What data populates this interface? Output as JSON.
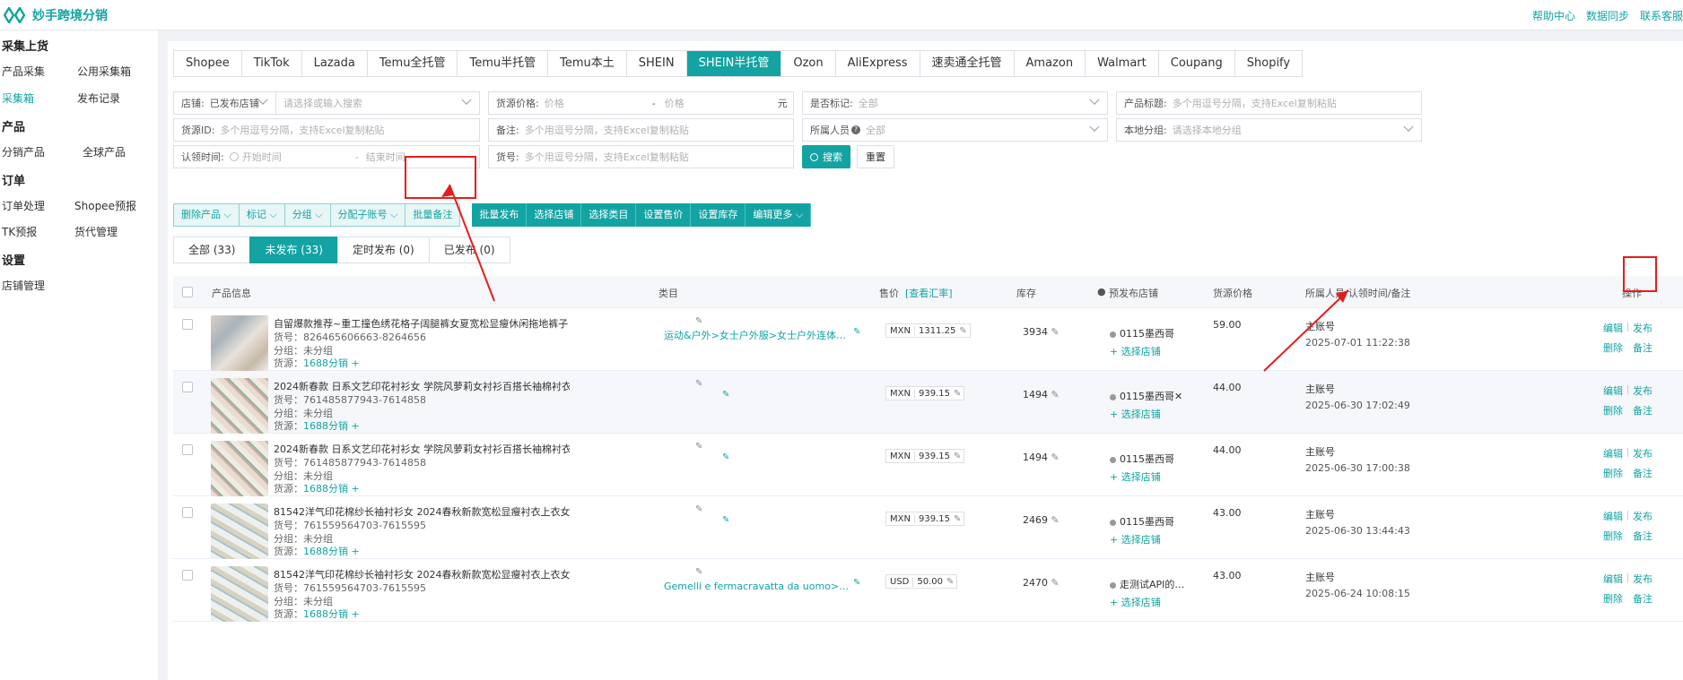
{
  "header": {
    "logo_text": "妙手跨境分销",
    "links": [
      "帮助中心",
      "数据同步",
      "联系客服"
    ]
  },
  "sidebar": {
    "sections": [
      {
        "title": "采集上货",
        "items": [
          "产品采集",
          "公用采集箱",
          "采集箱",
          "发布记录"
        ]
      },
      {
        "title": "产品",
        "items": [
          "分销产品",
          "全球产品"
        ]
      },
      {
        "title": "订单",
        "items": [
          "订单处理",
          "Shopee预报",
          "TK预报",
          "货代管理"
        ]
      },
      {
        "title": "设置",
        "items": [
          "店铺管理"
        ]
      }
    ],
    "active_item": "采集箱"
  },
  "platform_tabs": [
    "Shopee",
    "TikTok",
    "Lazada",
    "Temu全托管",
    "Temu半托管",
    "Temu本土",
    "SHEIN",
    "SHEIN半托管",
    "Ozon",
    "AliExpress",
    "速卖通全托管",
    "Amazon",
    "Walmart",
    "Coupang",
    "Shopify"
  ],
  "active_platform": "SHEIN半托管",
  "filters": {
    "store_label": "店铺:",
    "store_value": "已发布店铺",
    "store_search_ph": "请选择或输入搜索",
    "source_price_label": "货源价格:",
    "price_min_ph": "价格",
    "price_sep": "-",
    "price_max_ph": "价格",
    "price_unit": "元",
    "marked_label": "是否标记:",
    "marked_value": "全部",
    "title_label": "产品标题:",
    "title_ph": "多个用逗号分隔，支持Excel复制粘贴",
    "source_id_label": "货源ID:",
    "source_id_ph": "多个用逗号分隔，支持Excel复制粘贴",
    "note_label": "备注:",
    "note_ph": "多个用逗号分隔，支持Excel复制粘贴",
    "owner_label": "所属人员",
    "owner_value": "全部",
    "group_label": "本地分组:",
    "group_ph": "请选择本地分组",
    "claim_label": "认领时间:",
    "claim_start_ph": "开始时间",
    "claim_sep": "-",
    "claim_end_ph": "结束时间",
    "sku_label": "货号:",
    "sku_ph": "多个用逗号分隔，支持Excel复制粘贴",
    "search_btn": "搜索",
    "reset_btn": "重置"
  },
  "action_bar": {
    "light": [
      "删除产品",
      "标记",
      "分组",
      "分配子账号",
      "批量备注"
    ],
    "dark": [
      "批量发布",
      "选择店铺",
      "选择类目",
      "设置售价",
      "设置库存",
      "编辑更多"
    ]
  },
  "status_tabs": [
    "全部 (33)",
    "未发布 (33)",
    "定时发布 (0)",
    "已发布 (0)"
  ],
  "active_status": "未发布 (33)",
  "table_headers": {
    "product": "产品信息",
    "category": "类目",
    "price": "售价",
    "rate_link": "[查看汇率]",
    "stock": "库存",
    "shop": "预发布店铺",
    "source_price": "货源价格",
    "owner": "所属人员/认领时间/备注",
    "ops": "操作"
  },
  "rows": [
    {
      "title": "自留爆款推荐~重工撞色绣花格子阔腿裤女夏宽松显瘦休闲拖地裤子",
      "sku": "货号：826465606663-8264656",
      "group": "分组：未分组",
      "source_label": "货源：",
      "source": "1688分销",
      "category": "运动&户外>女士户外服>女士户外连体衣&连…",
      "currency": "MXN",
      "price": "1311.25",
      "stock": "3934",
      "shop": "0115墨西哥",
      "add_shop": "+ 选择店铺",
      "source_price": "59.00",
      "owner": "主账号",
      "time": "2025-07-01 11:22:38",
      "op_edit": "编辑",
      "op_publish": "发布",
      "op_delete": "删除",
      "op_note": "备注"
    },
    {
      "title": "2024新春款 日系文艺印花衬衫女 学院风萝莉女衬衫百搭长袖棉衬衣",
      "sku": "货号：761485877943-7614858",
      "group": "分组：未分组",
      "source_label": "货源：",
      "source": "1688分销",
      "category": "",
      "currency": "MXN",
      "price": "939.15",
      "stock": "1494",
      "shop": "0115墨西哥✕",
      "add_shop": "+ 选择店铺",
      "source_price": "44.00",
      "owner": "主账号",
      "time": "2025-06-30 17:02:49",
      "op_edit": "编辑",
      "op_publish": "发布",
      "op_delete": "删除",
      "op_note": "备注"
    },
    {
      "title": "2024新春款 日系文艺印花衬衫女 学院风萝莉女衬衫百搭长袖棉衬衣",
      "sku": "货号：761485877943-7614858",
      "group": "分组：未分组",
      "source_label": "货源：",
      "source": "1688分销",
      "category": "",
      "currency": "MXN",
      "price": "939.15",
      "stock": "1494",
      "shop": "0115墨西哥",
      "add_shop": "+ 选择店铺",
      "source_price": "44.00",
      "owner": "主账号",
      "time": "2025-06-30 17:00:38",
      "op_edit": "编辑",
      "op_publish": "发布",
      "op_delete": "删除",
      "op_note": "备注"
    },
    {
      "title": "81542洋气印花棉纱长袖衬衫女 2024春秋新款宽松显瘦衬衣上衣女",
      "sku": "货号：761559564703-7615595",
      "group": "分组：未分组",
      "source_label": "货源：",
      "source": "1688分销",
      "category": "",
      "currency": "MXN",
      "price": "939.15",
      "stock": "2469",
      "shop": "0115墨西哥",
      "add_shop": "+ 选择店铺",
      "source_price": "43.00",
      "owner": "主账号",
      "time": "2025-06-30 13:44:43",
      "op_edit": "编辑",
      "op_publish": "发布",
      "op_delete": "删除",
      "op_note": "备注"
    },
    {
      "title": "81542洋气印花棉纱长袖衬衫女 2024春秋新款宽松显瘦衬衣上衣女",
      "sku": "货号：761559564703-7615595",
      "group": "分组：未分组",
      "source_label": "货源：",
      "source": "1688分销",
      "category": "Gemelli e fermacravatta da uomo>定制女士…",
      "currency": "USD",
      "price": "50.00",
      "stock": "2470",
      "shop": "走测试API的…",
      "add_shop": "+ 选择店铺",
      "source_price": "43.00",
      "owner": "主账号",
      "time": "2025-06-24 10:08:15",
      "op_edit": "编辑",
      "op_publish": "发布",
      "op_delete": "删除",
      "op_note": "备注"
    }
  ],
  "colors": {
    "accent": "#13a3a3",
    "highlight": "#e61c1c"
  }
}
